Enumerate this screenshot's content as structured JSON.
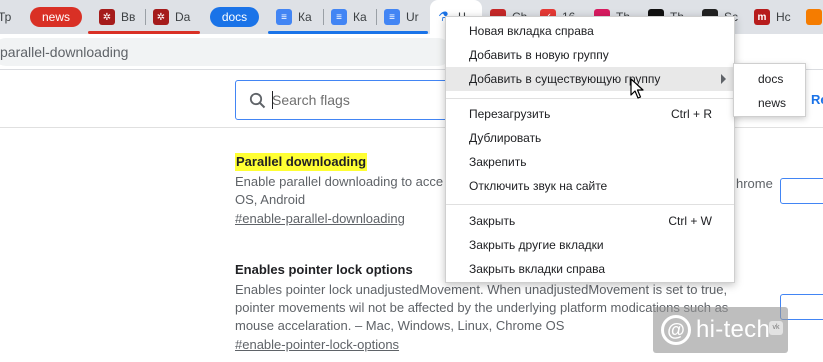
{
  "tabs": {
    "partial_left": "Тр",
    "group_news": {
      "label": "news",
      "color": "#d93025"
    },
    "group_docs": {
      "label": "docs",
      "color": "#1a73e8"
    },
    "news_tabs": [
      {
        "title": "Вв",
        "icon": "dotted-red-icon"
      },
      {
        "title": "Da",
        "icon": "dotted-red-icon"
      }
    ],
    "docs_tabs": [
      {
        "title": "Ка",
        "icon": "google-docs-icon"
      },
      {
        "title": "Ка",
        "icon": "google-docs-icon"
      },
      {
        "title": "Ur",
        "icon": "google-docs-icon"
      }
    ],
    "active_tab": {
      "title": "Ч",
      "icon": "flags-icon"
    },
    "other_tabs": [
      {
        "title": "Ch",
        "icon": "red-square-icon"
      },
      {
        "title": "16",
        "icon": "red-check-icon"
      },
      {
        "title": "Th",
        "icon": "pink-square-icon"
      },
      {
        "title": "Th",
        "icon": "black-square-icon"
      },
      {
        "title": "Sc",
        "icon": "black-square-icon"
      },
      {
        "title": "Hc",
        "icon": "m-logo-icon"
      },
      {
        "title": "",
        "icon": "orange-icon"
      }
    ]
  },
  "address_bar": {
    "url_fragment": "parallel-downloading"
  },
  "flags_page": {
    "search_placeholder": "Search flags",
    "reset_label": "Re",
    "flags": [
      {
        "title": "Parallel downloading",
        "description": "Enable parallel downloading to accelerate download speed. – Mac, Windows, Linux, Chrome OS, Android",
        "desc_line1_visible": "Enable parallel downloading to acce",
        "desc_line1_tail": "hrome",
        "desc_line2": "OS, Android",
        "link": "#enable-parallel-downloading"
      },
      {
        "title": "Enables pointer lock options",
        "desc_line1_visible": "Enables pointer lock unadjustedMovement. When unadjustedMovement is set to true,",
        "desc_line2": "pointer movements wil not be affected by the underlying platform modications such as",
        "desc_line3": "mouse accelaration. – Mac, Windows, Linux, Chrome OS",
        "link": "#enable-pointer-lock-options"
      }
    ]
  },
  "context_menu": {
    "items": [
      {
        "label": "Новая вкладка справа",
        "shortcut": ""
      },
      {
        "label": "Добавить в новую группу",
        "shortcut": ""
      },
      {
        "label": "Добавить в существующую группу",
        "shortcut": "",
        "has_submenu": true
      },
      {
        "label": "Перезагрузить",
        "shortcut": "Ctrl + R"
      },
      {
        "label": "Дублировать",
        "shortcut": ""
      },
      {
        "label": "Закрепить",
        "shortcut": ""
      },
      {
        "label": "Отключить звук на сайте",
        "shortcut": ""
      },
      {
        "label": "Закрыть",
        "shortcut": "Ctrl + W"
      },
      {
        "label": "Закрыть другие вкладки",
        "shortcut": ""
      },
      {
        "label": "Закрыть вкладки справа",
        "shortcut": ""
      }
    ],
    "submenu": [
      "docs",
      "news"
    ]
  },
  "watermark": {
    "text": "hi-tech",
    "at": "@",
    "badge": "vk"
  }
}
